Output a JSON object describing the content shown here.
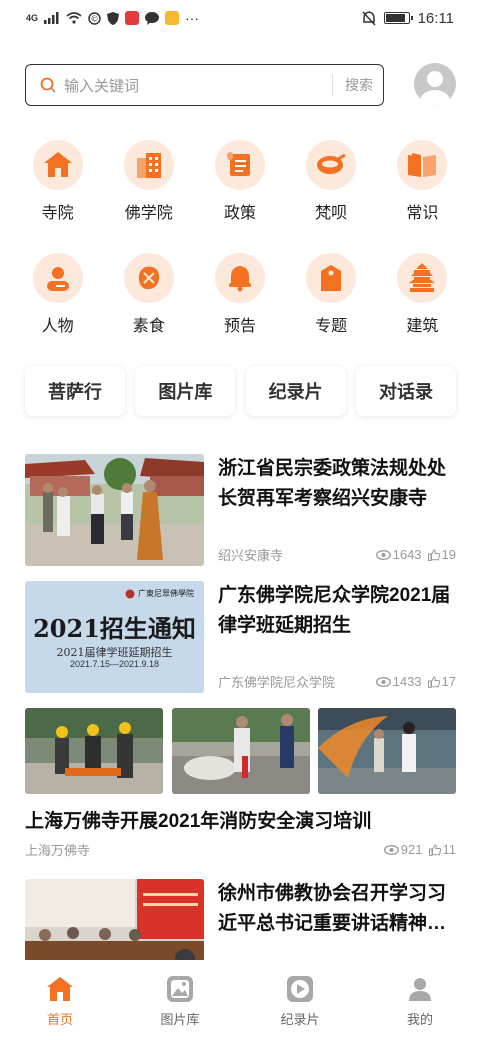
{
  "status_bar": {
    "network": "4G",
    "time": "16:11",
    "more": "···"
  },
  "search": {
    "placeholder": "输入关键词",
    "button_label": "搜索"
  },
  "categories": [
    {
      "label": "寺院",
      "icon": "temple-icon"
    },
    {
      "label": "佛学院",
      "icon": "academy-icon"
    },
    {
      "label": "政策",
      "icon": "policy-scroll-icon"
    },
    {
      "label": "梵呗",
      "icon": "chant-icon"
    },
    {
      "label": "常识",
      "icon": "book-icon"
    },
    {
      "label": "人物",
      "icon": "person-icon"
    },
    {
      "label": "素食",
      "icon": "vegetarian-icon"
    },
    {
      "label": "预告",
      "icon": "bell-icon"
    },
    {
      "label": "专题",
      "icon": "topic-tag-icon"
    },
    {
      "label": "建筑",
      "icon": "pagoda-icon"
    }
  ],
  "quick_tabs": [
    "菩萨行",
    "图片库",
    "纪录片",
    "对话录"
  ],
  "feed": {
    "item1": {
      "title": "浙江省民宗委政策法规处处长贺再军考察绍兴安康寺",
      "source": "绍兴安康寺",
      "views": "1643",
      "likes": "19"
    },
    "item2": {
      "title": "广东佛学院尼众学院2021届律学班延期招生",
      "source": "广东佛学院尼众学院",
      "views": "1433",
      "likes": "17",
      "poster_org": "广東尼眾佛學院",
      "poster_heading": "2021招生通知",
      "poster_sub": "2021届律学班延期招生",
      "poster_dates": "2021.7.15—2021.9.18"
    },
    "item3": {
      "title": "上海万佛寺开展2021年消防安全演习培训",
      "source": "上海万佛寺",
      "views": "921",
      "likes": "11"
    },
    "item4": {
      "title": "徐州市佛教协会召开学习习近平总书记重要讲话精神座谈会",
      "source": "",
      "views": "",
      "likes": ""
    }
  },
  "bottom_nav": [
    {
      "label": "首页",
      "icon": "home-icon",
      "active": true
    },
    {
      "label": "图片库",
      "icon": "gallery-icon",
      "active": false
    },
    {
      "label": "纪录片",
      "icon": "play-icon",
      "active": false
    },
    {
      "label": "我的",
      "icon": "user-icon",
      "active": false
    }
  ],
  "colors": {
    "accent": "#f37121",
    "icon_bg": "#fde9dc"
  }
}
